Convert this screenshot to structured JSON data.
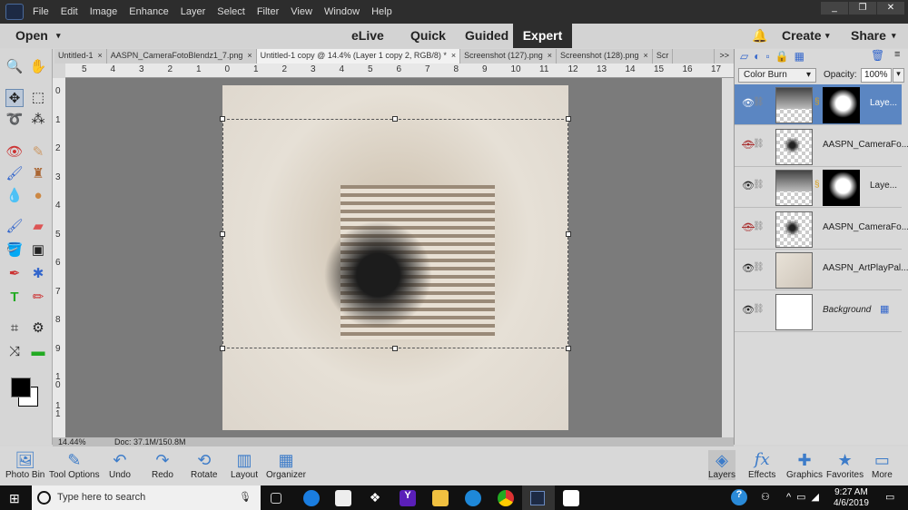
{
  "menubar": {
    "items": [
      "File",
      "Edit",
      "Image",
      "Enhance",
      "Layer",
      "Select",
      "Filter",
      "View",
      "Window",
      "Help"
    ],
    "window_controls": [
      "_",
      "❐",
      "✕"
    ]
  },
  "modebar": {
    "open": "Open",
    "modes": [
      "eLive",
      "Quick",
      "Guided",
      "Expert"
    ],
    "active_mode": "Expert",
    "create": "Create",
    "share": "Share"
  },
  "doc_tabs": [
    {
      "label": "Untitled-1",
      "active": false
    },
    {
      "label": "AASPN_CameraFotoBlendz1_7.png",
      "active": false
    },
    {
      "label": "Untitled-1 copy @ 14.4% (Layer 1 copy 2, RGB/8) *",
      "active": true
    },
    {
      "label": "Screenshot (127).png",
      "active": false
    },
    {
      "label": "Screenshot (128).png",
      "active": false
    },
    {
      "label": "Scr",
      "active": false
    }
  ],
  "tabs_overflow": ">>",
  "ruler": {
    "h": [
      "5",
      "4",
      "3",
      "2",
      "1",
      "0",
      "1",
      "2",
      "3",
      "4",
      "5",
      "6",
      "7",
      "8",
      "9",
      "10",
      "11",
      "12",
      "13",
      "14",
      "15",
      "16",
      "17"
    ],
    "v": [
      "0",
      "1",
      "2",
      "3",
      "4",
      "5",
      "6",
      "7",
      "8",
      "9",
      "1 0",
      "1 1"
    ]
  },
  "status": {
    "zoom": "14.44%",
    "doc": "Doc: 37.1M/150.8M"
  },
  "layers_panel": {
    "blend_mode": "Color Burn",
    "opacity_label": "Opacity:",
    "opacity": "100%",
    "layers": [
      {
        "name": "Laye...",
        "visible": true,
        "selected": true,
        "mask": true,
        "type": "photo"
      },
      {
        "name": "AASPN_CameraFo...",
        "visible": false,
        "selected": false,
        "mask": false,
        "type": "blur"
      },
      {
        "name": "Laye...",
        "visible": true,
        "selected": false,
        "mask": true,
        "type": "photo"
      },
      {
        "name": "AASPN_CameraFo...",
        "visible": false,
        "selected": false,
        "mask": false,
        "type": "blur"
      },
      {
        "name": "AASPN_ArtPlayPal...",
        "visible": true,
        "selected": false,
        "mask": false,
        "type": "paper"
      },
      {
        "name": "Background",
        "visible": true,
        "selected": false,
        "mask": false,
        "type": "white"
      }
    ]
  },
  "bottombar": {
    "left": [
      {
        "label": "Photo Bin",
        "icon": "photo-bin-icon"
      },
      {
        "label": "Tool Options",
        "icon": "tool-options-icon"
      },
      {
        "label": "Undo",
        "icon": "undo-icon"
      },
      {
        "label": "Redo",
        "icon": "redo-icon"
      },
      {
        "label": "Rotate",
        "icon": "rotate-icon"
      },
      {
        "label": "Layout",
        "icon": "layout-icon"
      },
      {
        "label": "Organizer",
        "icon": "organizer-icon"
      }
    ],
    "right": [
      {
        "label": "Layers",
        "icon": "layers-icon"
      },
      {
        "label": "Effects",
        "icon": "fx-icon"
      },
      {
        "label": "Graphics",
        "icon": "plus-icon"
      },
      {
        "label": "Favorites",
        "icon": "star-icon"
      },
      {
        "label": "More",
        "icon": "more-icon"
      }
    ]
  },
  "taskbar": {
    "search_placeholder": "Type here to search",
    "time": "9:27 AM",
    "date": "4/6/2019"
  },
  "colors": {
    "accent": "#5b86c2",
    "menubar": "#2d2d2d",
    "canvas_bg": "#7b7b7b"
  }
}
